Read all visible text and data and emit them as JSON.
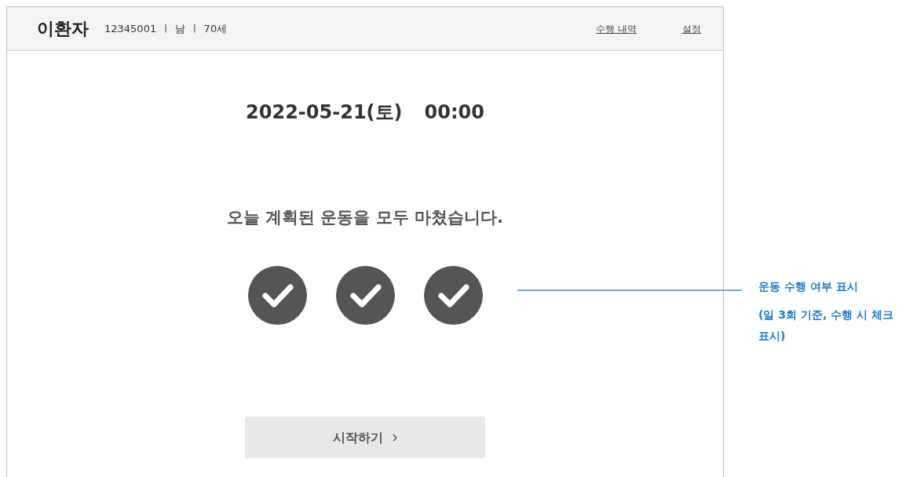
{
  "header": {
    "patient_name": "이환자",
    "patient_id": "12345001",
    "sex": "남",
    "age": "70세",
    "separator": "|",
    "links": [
      "수행 내역",
      "설정"
    ]
  },
  "date": "2022-05-21(토)",
  "time": "00:00",
  "message": "오늘 계획된 운동을 모두 마쳤습니다.",
  "sessions": [
    {
      "done": true
    },
    {
      "done": true
    },
    {
      "done": true
    }
  ],
  "start_button": {
    "label": "시작하기"
  },
  "annotation": {
    "title": "운동 수행 여부 표시",
    "note": "(일 3회 기준, 수행 시 체크 표시)"
  }
}
